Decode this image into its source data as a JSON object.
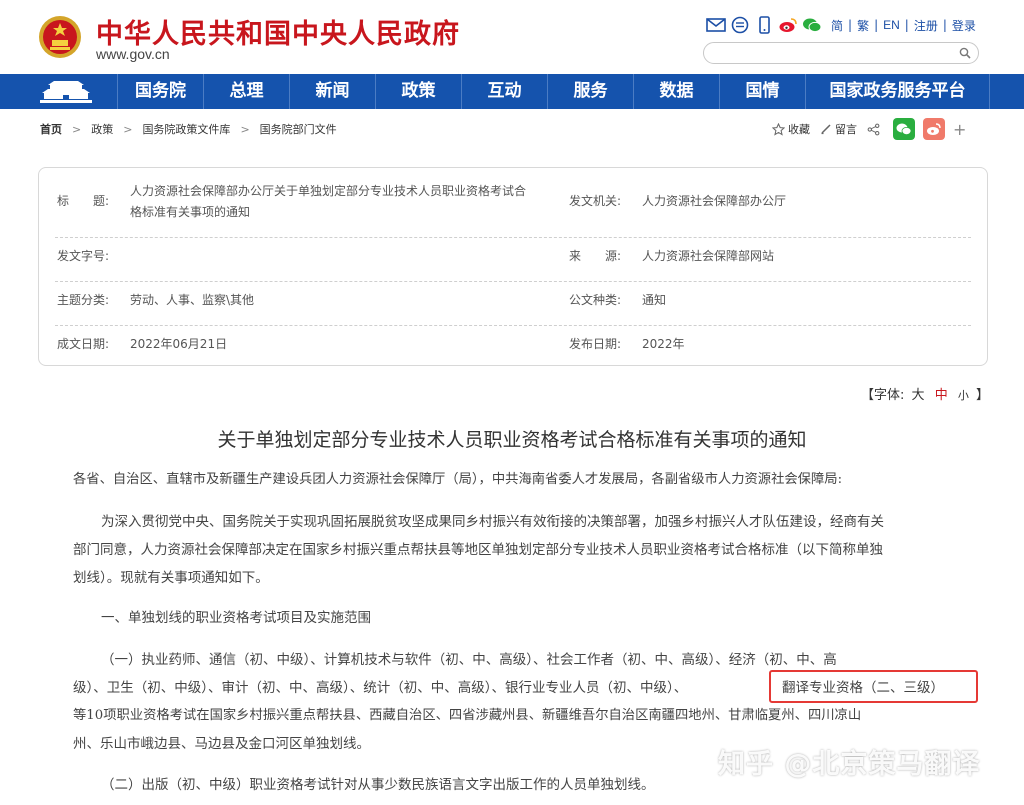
{
  "header": {
    "site_title": "中华人民共和国中央人民政府",
    "site_url": "www.gov.cn",
    "lang_links": [
      "简",
      "繁",
      "EN",
      "注册",
      "登录"
    ],
    "icons": [
      "mail-icon",
      "message-icon",
      "mobile-icon",
      "weibo-icon",
      "wechat-icon"
    ],
    "brand_color": "#c8161d"
  },
  "nav": {
    "color": "#1553ad",
    "items": [
      "国务院",
      "总理",
      "新闻",
      "政策",
      "互动",
      "服务",
      "数据",
      "国情",
      "国家政务服务平台"
    ]
  },
  "breadcrumb": [
    "首页",
    "政策",
    "国务院政策文件库",
    "国务院部门文件"
  ],
  "tools": {
    "favorite": "收藏",
    "comment": "留言"
  },
  "info": {
    "title_label": "标　　题:",
    "title_value_line1": "人力资源社会保障部办公厅关于单独划定部分专业技术人员职业资格考试合",
    "title_value_line2": "格标准有关事项的通知",
    "issuer_label": "发文机关:",
    "issuer_value": "人力资源社会保障部办公厅",
    "docno_label": "发文字号:",
    "docno_value": "",
    "source_label": "来　　源:",
    "source_value": "人力资源社会保障部网站",
    "topic_label": "主题分类:",
    "topic_value": "劳动、人事、监察\\其他",
    "type_label": "公文种类:",
    "type_value": "通知",
    "created_label": "成文日期:",
    "created_value": "2022年06月21日",
    "published_label": "发布日期:",
    "published_value": "2022年"
  },
  "fontsize": {
    "prefix": "【字体:",
    "large": "大",
    "medium": "中",
    "small": "小",
    "suffix": "】"
  },
  "article": {
    "title": "关于单独划定部分专业技术人员职业资格考试合格标准有关事项的通知",
    "salutation": "各省、自治区、直辖市及新疆生产建设兵团人力资源社会保障厅（局），中共海南省委人才发展局，各副省级市人力资源社会保障局:",
    "p1_line1": "为深入贯彻党中央、国务院关于实现巩固拓展脱贫攻坚成果同乡村振兴有效衔接的决策部署，加强乡村振兴人才队伍建设，经商有关",
    "p1_line2": "部门同意，人力资源社会保障部决定在国家乡村振兴重点帮扶县等地区单独划定部分专业技术人员职业资格考试合格标准（以下简称单独",
    "p1_line3": "划线）。现就有关事项通知如下。",
    "section1": "一、单独划线的职业资格考试项目及实施范围",
    "p2_line1": "（一）执业药师、通信（初、中级）、计算机技术与软件（初、中、高级）、社会工作者（初、中、高级）、经济（初、中、高",
    "p2_line2a": "级）、卫生（初、中级）、审计（初、中、高级）、统计（初、中、高级）、银行业专业人员（初、中级）、",
    "p2_line2b": "翻译专业资格（二、三级）",
    "p2_line3": "等10项职业资格考试在国家乡村振兴重点帮扶县、西藏自治区、四省涉藏州县、新疆维吾尔自治区南疆四地州、甘肃临夏州、四川凉山",
    "p2_line4": "州、乐山市峨边县、马边县及金口河区单独划线。",
    "p3": "（二）出版（初、中级）职业资格考试针对从事少数民族语言文字出版工作的人员单独划线。"
  },
  "watermark": "知乎 @北京策马翻译"
}
